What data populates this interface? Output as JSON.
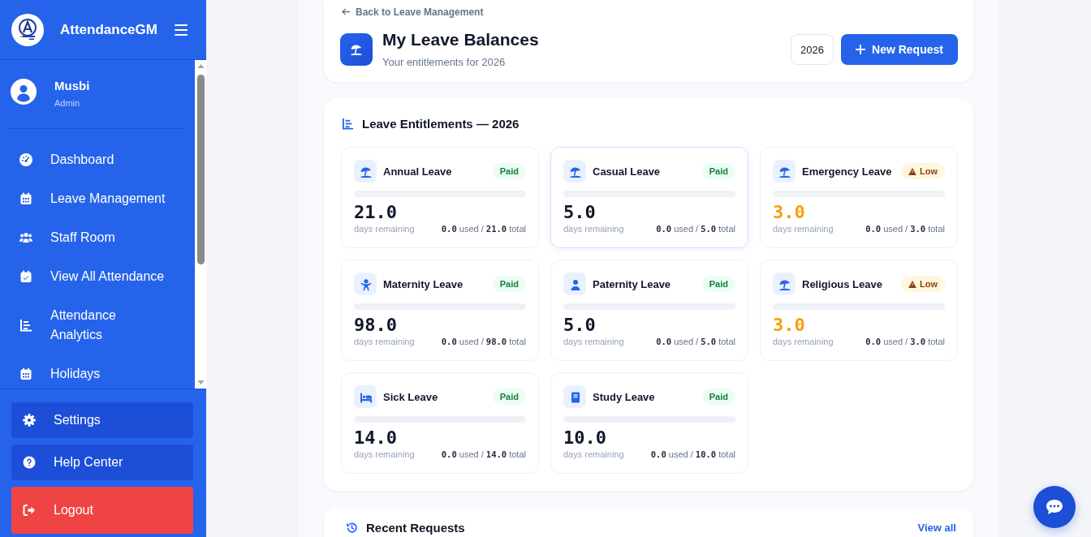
{
  "sidebar": {
    "brand": "AttendanceGM",
    "user": {
      "name": "Musbi",
      "role": "Admin"
    },
    "nav": [
      {
        "label": "Dashboard"
      },
      {
        "label": "Leave Management"
      },
      {
        "label": "Staff Room"
      },
      {
        "label": "View All Attendance"
      },
      {
        "label": "Attendance Analytics"
      },
      {
        "label": "Holidays"
      }
    ],
    "footer_buttons": [
      {
        "label": "Settings",
        "kind": "settings"
      },
      {
        "label": "Help Center",
        "kind": "help"
      },
      {
        "label": "Logout",
        "kind": "logout"
      }
    ]
  },
  "header": {
    "back_link": "Back to Leave Management",
    "title": "My Leave Balances",
    "subtitle": "Your entitlements for 2026",
    "year_select": {
      "value": "2026"
    },
    "new_button": "New Request"
  },
  "entitlements": {
    "title": "Leave Entitlements — 2026",
    "cards": [
      {
        "name": "Annual Leave",
        "badge": {
          "kind": "paid",
          "label": "Paid"
        },
        "level": 0,
        "remaining": "21.0",
        "remaining_label": "days remaining",
        "usage": "**0.0** used / **21.0** total",
        "highlighted": false
      },
      {
        "name": "Casual Leave",
        "badge": {
          "kind": "paid",
          "label": "Paid"
        },
        "level": 0,
        "remaining": "5.0",
        "remaining_label": "days remaining",
        "usage": "**0.0** used / **5.0** total",
        "highlighted": true
      },
      {
        "name": "Emergency Leave",
        "badge": {
          "kind": "low",
          "label": "Low"
        },
        "level": 0,
        "remaining": "3.0",
        "remaining_label": "days remaining",
        "usage": "**0.0** used / **3.0** total",
        "highlighted": false
      },
      {
        "name": "Maternity Leave",
        "badge": {
          "kind": "paid",
          "label": "Paid"
        },
        "level": 0,
        "remaining": "98.0",
        "remaining_label": "days remaining",
        "usage": "**0.0** used / **98.0** total",
        "highlighted": false
      },
      {
        "name": "Paternity Leave",
        "badge": {
          "kind": "paid",
          "label": "Paid"
        },
        "level": 0,
        "remaining": "5.0",
        "remaining_label": "days remaining",
        "usage": "**0.0** used / **5.0** total",
        "highlighted": false
      },
      {
        "name": "Religious Leave",
        "badge": {
          "kind": "low",
          "label": "Low"
        },
        "level": 0,
        "remaining": "3.0",
        "remaining_label": "days remaining",
        "usage": "**0.0** used / **3.0** total",
        "highlighted": false
      },
      {
        "name": "Sick Leave",
        "badge": {
          "kind": "paid",
          "label": "Paid"
        },
        "level": 0,
        "remaining": "14.0",
        "remaining_label": "days remaining",
        "usage": "**0.0** used / **14.0** total",
        "highlighted": false
      },
      {
        "name": "Study Leave",
        "badge": {
          "kind": "paid",
          "label": "Paid"
        },
        "level": 0,
        "remaining": "10.0",
        "remaining_label": "days remaining",
        "usage": "**0.0** used / **10.0** total",
        "highlighted": false
      }
    ]
  },
  "recent": {
    "title": "Recent Requests",
    "link": "View all"
  }
}
